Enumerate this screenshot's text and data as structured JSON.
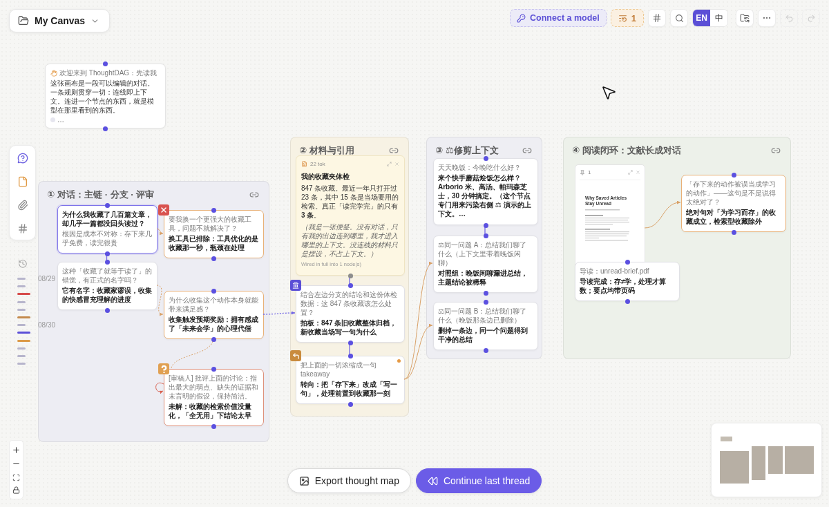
{
  "canvas_menu": {
    "title": "My Canvas"
  },
  "toolbar": {
    "connect_label": "Connect a model",
    "queue_count": "1",
    "languages": [
      {
        "label": "EN",
        "selected": true
      },
      {
        "label": "中",
        "selected": false
      }
    ],
    "history": [
      {
        "kind": "undo",
        "disabled": true
      },
      {
        "kind": "redo",
        "disabled": true
      }
    ]
  },
  "timeline": [
    {
      "kind": "plain",
      "color": "#b7b5cc",
      "date": "08/29"
    },
    {
      "kind": "plain",
      "color": "#b7b5cc"
    },
    {
      "kind": "marked",
      "color": "#d64b4b"
    },
    {
      "kind": "plain",
      "color": "#b7b5cc"
    },
    {
      "kind": "plain",
      "color": "#b7b5cc"
    },
    {
      "kind": "marked",
      "color": "#c48a4c"
    },
    {
      "kind": "plain",
      "color": "#b7b5cc",
      "date": "08/30"
    },
    {
      "kind": "marked",
      "color": "#5b4fd8"
    },
    {
      "kind": "marked",
      "color": "#dc9a48"
    },
    {
      "kind": "plain",
      "color": "#b7b5cc"
    },
    {
      "kind": "plain",
      "color": "#b7b5cc"
    },
    {
      "kind": "plain",
      "color": "#b7b5cc"
    }
  ],
  "welcome_note": {
    "header": "欢迎来到 ThoughtDAG：先读我",
    "body": "这张画布是一段可以编辑的对话。一条规则贯穿一切：连线即上下文。连进一个节点的东西，就是模型在那里看到的东西。",
    "ellipsis": "…"
  },
  "groups": [
    {
      "number": "①",
      "title": "对话：主链 · 分支 · 评审",
      "color": "#ededf3",
      "nodes": [
        {
          "kind": "root",
          "selected": true,
          "flagged": false,
          "prompt": "为什么我收藏了几百篇文章，却几乎一篇都没回头读过？",
          "reply": "根因是成本不对称：存下来几乎免费，读完很贵"
        },
        {
          "kind": "rejected",
          "selected": false,
          "flagged": false,
          "color": "#e8b077",
          "prompt": "要我换一个更强大的收藏工具，问题不就解决了？",
          "reply": "换工具已排除：工具优化的是收藏那一秒，瓶颈在处理"
        },
        {
          "kind": "chat",
          "selected": false,
          "flagged": false,
          "color": "#e1e1e6",
          "prompt": "这种「收藏了就等于读了」的错觉，有正式的名字吗？",
          "reply": "它有名字：收藏家谬误，收集的快感冒充理解的进度"
        },
        {
          "kind": "chat",
          "selected": false,
          "flagged": false,
          "color": "#e8b077",
          "prompt": "为什么收集这个动作本身就能带来满足感？",
          "reply": "收集触发预期奖励：拥有感成了「未来会学」的心理代偿"
        },
        {
          "kind": "question",
          "selected": false,
          "flagged": false,
          "color": "#de907a",
          "prompt": "[审稿人] 批评上面的讨论：指出最大的弱点、缺失的证据和未言明的假设，保持简洁。",
          "reply": "未解：收藏的检索价值没量化，「全无用」下结论太早"
        }
      ]
    },
    {
      "number": "②",
      "title": "材料与引用",
      "color": "#f7f2e4",
      "nodes": [
        {
          "kind": "note",
          "meta": "22 tok",
          "title": "我的收藏夹体检",
          "body": "847 条收藏。最近一年只打开过 23 条，其中 15 条是当场要用的检索。真正「读完学完」的只有 **3 条**。",
          "aside": "（我是一张便签。没有对话，只有我的出边连到哪里，我才进入哪里的上下文。没连线的材料只是摆设，不占上下文。）",
          "footer": "Wired in full into 1 node(s)"
        },
        {
          "kind": "decision",
          "selected": false,
          "flagged": false,
          "color": "#e1e1e6",
          "prompt": "结合左边分支的结论和这份体检数据：这 847 条收藏该怎么处置？",
          "reply": "拍板：847 条旧收藏整体归档，新收藏当场写一句为什么"
        },
        {
          "kind": "pivot",
          "selected": false,
          "flagged": true,
          "color": "#e1e1e6",
          "prompt": "把上面的一切浓缩成一句 takeaway",
          "reply": "转向：把「存下来」改成「写一句」，处理前置到收藏那一刻"
        }
      ]
    },
    {
      "number": "③",
      "title": "⚖修剪上下文",
      "color": "#eeeef3",
      "nodes": [
        {
          "kind": "chat",
          "selected": false,
          "flagged": false,
          "color": "#e1e1e6",
          "prompt": "天天晚饭：今晚吃什么好？",
          "reply": "来个快手蘑菇烩饭怎么样？Arborio 米、高汤、帕玛森芝士，30 分钟搞定。（这个节点专门用来污染右侧 ⚖ 演示的上下文。…"
        },
        {
          "kind": "chat",
          "selected": false,
          "flagged": false,
          "color": "#e1e1e6",
          "prompt": "⚖同一问题 A：总结我们聊了什么（上下文里带着晚饭闲聊）",
          "reply": "对照组：晚饭闲聊漏进总结，主题结论被稀释"
        },
        {
          "kind": "chat",
          "selected": false,
          "flagged": false,
          "color": "#e1e1e6",
          "prompt": "⚖同一问题 B：总结我们聊了什么（晚饭那条边已删除）",
          "reply": "删掉一条边，同一个问题得到干净的总结"
        }
      ]
    },
    {
      "number": "④",
      "title": "阅读闭环：文献长成对话",
      "color": "#edf1ea",
      "nodes": [
        {
          "kind": "document",
          "meta": "1",
          "doc_title": "Why Saved Articles Stay Unread"
        },
        {
          "kind": "chat",
          "selected": false,
          "flagged": false,
          "color": "#e8b077",
          "prompt": "「存下来的动作被误当成学习的动作」——这句是不是说得太绝对了？",
          "reply": "绝对句对「为学习而存」的收藏成立，检索型收藏除外"
        },
        {
          "kind": "chat",
          "selected": false,
          "flagged": false,
          "color": "#e1e1e6",
          "prompt": "导读：unread-brief.pdf",
          "reply": "导读完成：存≠学，处理才算数；要点均带页码"
        }
      ]
    }
  ],
  "actions": [
    {
      "kind": "export",
      "label": "Export thought map"
    },
    {
      "kind": "continue",
      "label": "Continue last thread"
    }
  ]
}
